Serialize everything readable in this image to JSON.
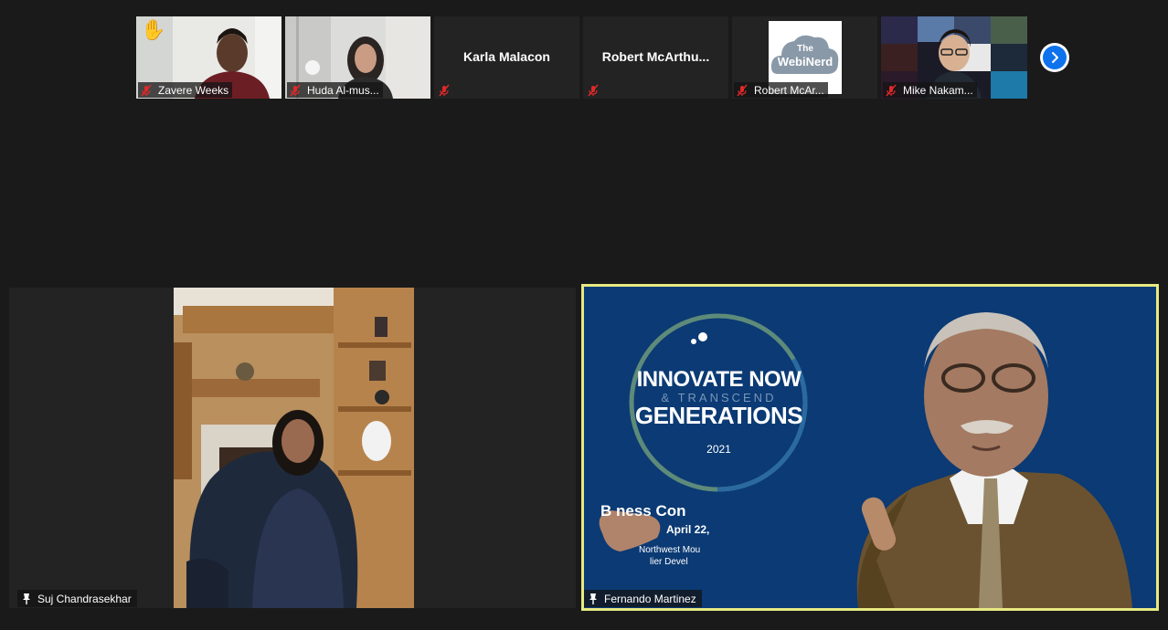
{
  "gallery": {
    "participants": [
      {
        "name": "Zavere Weeks",
        "raised_hand": true,
        "muted": true,
        "has_video": true
      },
      {
        "name": "Huda Al-mus...",
        "muted": true,
        "has_video": true
      },
      {
        "name": "Karla Malacon",
        "muted": true,
        "has_video": false
      },
      {
        "name": "Robert  McArthu...",
        "muted": true,
        "has_video": false
      },
      {
        "name": "Robert McAr...",
        "muted": true,
        "has_video": true,
        "logo_text": {
          "line1": "The",
          "line2": "WebiNerd"
        }
      },
      {
        "name": "Mike Nakam...",
        "muted": true,
        "has_video": true
      }
    ],
    "next_page_icon": "chevron-right-icon"
  },
  "main": {
    "speaker_left": {
      "name": "Suj Chandrasekhar"
    },
    "speaker_right": {
      "name": "Fernando Martinez",
      "slide": {
        "line1": "INNOVATE NOW",
        "line2": "& TRANSCEND",
        "line3": "GENERATIONS",
        "year": "2021",
        "sub1": "B  ness Con",
        "sub2": "April 22,",
        "sub3": "Northwest Mou",
        "sub4": "lier Devel"
      }
    },
    "active_speaker_color": "#e7ea82"
  },
  "colors": {
    "background": "#1a1a1a",
    "tile": "#232323",
    "accent": "#0e72ed",
    "mute": "#e02828"
  }
}
